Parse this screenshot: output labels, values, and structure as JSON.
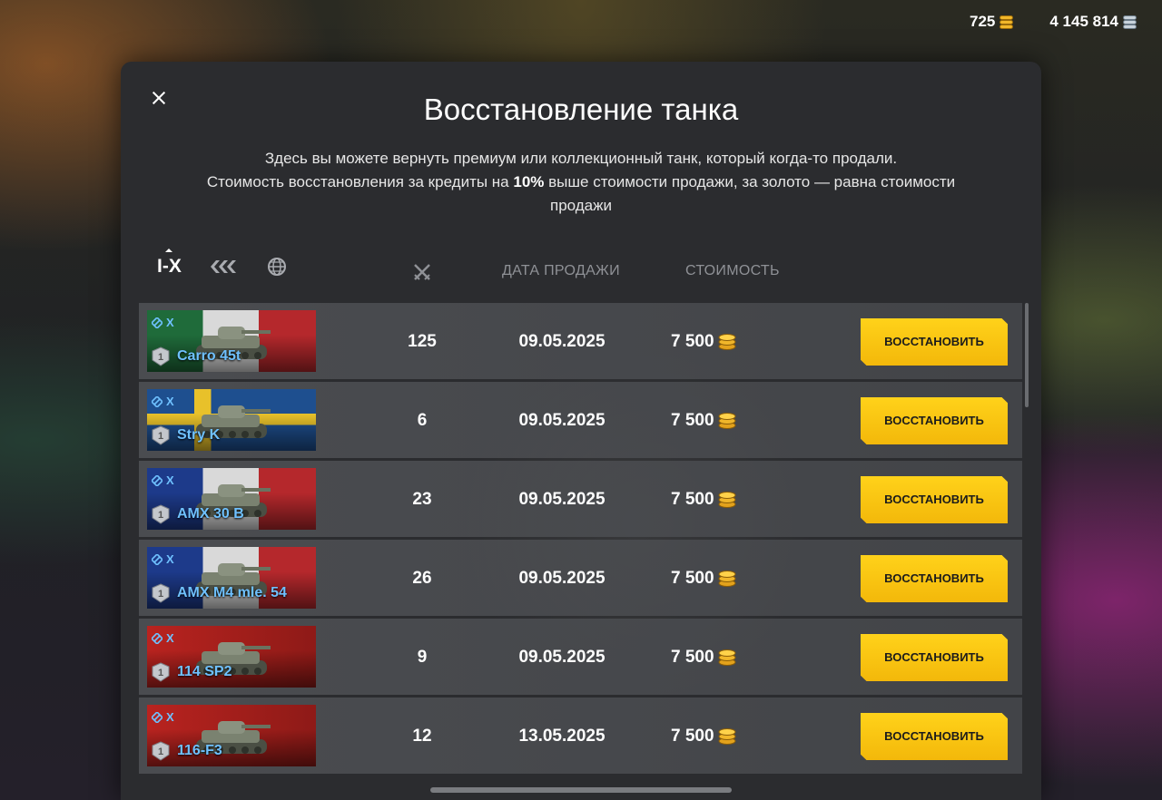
{
  "currency": {
    "gold": "725",
    "silver": "4 145 814"
  },
  "modal": {
    "title": "Восстановление танка",
    "desc_line1": "Здесь вы можете вернуть премиум или коллекционный танк, который когда-то продали.",
    "desc_line2_a": "Стоимость восстановления за кредиты на ",
    "desc_line2_bold": "10%",
    "desc_line2_b": " выше стоимости продажи, за золото — равна стоимости продажи"
  },
  "filters": {
    "tier_label": "I-X"
  },
  "columns": {
    "date": "ДАТА ПРОДАЖИ",
    "price": "СТОИМОСТЬ"
  },
  "restore_label": "ВОССТАНОВИТЬ",
  "tanks": [
    {
      "tier": "X",
      "mastery": "1",
      "name": "Carro 45t",
      "battles": "125",
      "date": "09.05.2025",
      "price": "7 500",
      "flag": "italy"
    },
    {
      "tier": "X",
      "mastery": "1",
      "name": "Stry K",
      "battles": "6",
      "date": "09.05.2025",
      "price": "7 500",
      "flag": "sweden"
    },
    {
      "tier": "X",
      "mastery": "1",
      "name": "AMX 30 B",
      "battles": "23",
      "date": "09.05.2025",
      "price": "7 500",
      "flag": "france"
    },
    {
      "tier": "X",
      "mastery": "1",
      "name": "AMX M4 mle. 54",
      "battles": "26",
      "date": "09.05.2025",
      "price": "7 500",
      "flag": "france"
    },
    {
      "tier": "X",
      "mastery": "1",
      "name": "114 SP2",
      "battles": "9",
      "date": "09.05.2025",
      "price": "7 500",
      "flag": "china"
    },
    {
      "tier": "X",
      "mastery": "1",
      "name": "116-F3",
      "battles": "12",
      "date": "13.05.2025",
      "price": "7 500",
      "flag": "china"
    }
  ],
  "colors": {
    "accent_yellow": "#ffd21a",
    "tank_name_blue": "#6fc1ff"
  }
}
